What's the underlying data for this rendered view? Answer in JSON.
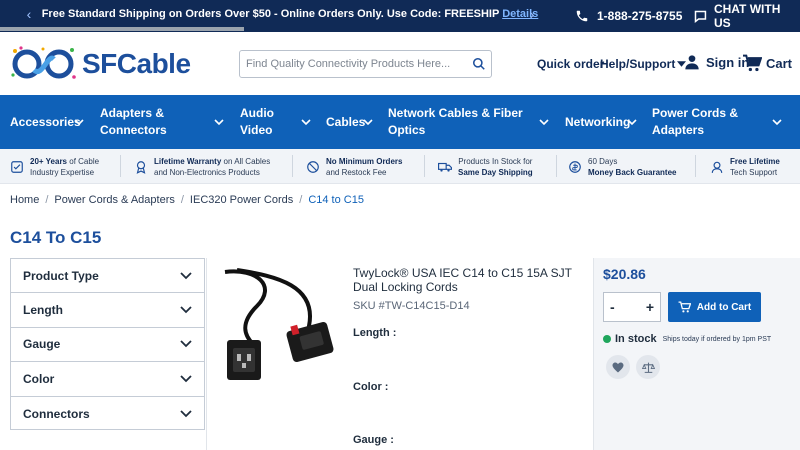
{
  "topbar": {
    "promo_text": "Free Standard Shipping on Orders Over $50 - Online Orders Only. Use Code: FREESHIP",
    "promo_link": "Details",
    "phone": "1-888-275-8755",
    "chat": "CHAT WITH US"
  },
  "header": {
    "logo_text": "SFCable",
    "search_placeholder": "Find Quality Connectivity Products Here...",
    "quick_order": "Quick order",
    "help": "Help/Support",
    "sign_in": "Sign in",
    "cart": "Cart"
  },
  "nav": {
    "items": [
      {
        "label": "Accessories"
      },
      {
        "label": "Adapters & Connectors"
      },
      {
        "label": "Audio Video"
      },
      {
        "label": "Cables"
      },
      {
        "label": "Network Cables & Fiber Optics"
      },
      {
        "label": "Networking"
      },
      {
        "label": "Power Cords & Adapters"
      }
    ]
  },
  "benefits": [
    {
      "bold": "20+ Years",
      "rest": "of Cable",
      "line2": "Industry Expertise"
    },
    {
      "bold": "Lifetime Warranty",
      "rest": "on All Cables",
      "line2": "and Non-Electronics Products"
    },
    {
      "bold": "No Minimum Orders",
      "rest": "",
      "line2": "and Restock Fee"
    },
    {
      "bold": "",
      "rest": "Products In Stock for",
      "line2": "Same Day Shipping"
    },
    {
      "bold": "",
      "rest": "60 Days",
      "line2": "Money Back Guarantee"
    },
    {
      "bold": "Free Lifetime",
      "rest": "",
      "line2": "Tech Support"
    }
  ],
  "breadcrumb": [
    "Home",
    "Power Cords & Adapters",
    "IEC320 Power Cords",
    "C14 to C15"
  ],
  "page_title": "C14 To C15",
  "filters": [
    "Product Type",
    "Length",
    "Gauge",
    "Color",
    "Connectors"
  ],
  "product": {
    "title": "TwyLock® USA IEC C14 to C15 15A SJT Dual Locking Cords",
    "sku": "SKU #TW-C14C15-D14",
    "attributes": [
      "Length :",
      "Color :",
      "Gauge :"
    ],
    "price": "$20.86",
    "qty_minus": "-",
    "qty_plus": "+",
    "add_to_cart": "Add to Cart",
    "stock": "In stock",
    "ship_note": "Ships today if ordered by 1pm PST"
  },
  "colors": {
    "navy": "#102a56",
    "blue": "#0f61b8",
    "green": "#1fa65c"
  }
}
